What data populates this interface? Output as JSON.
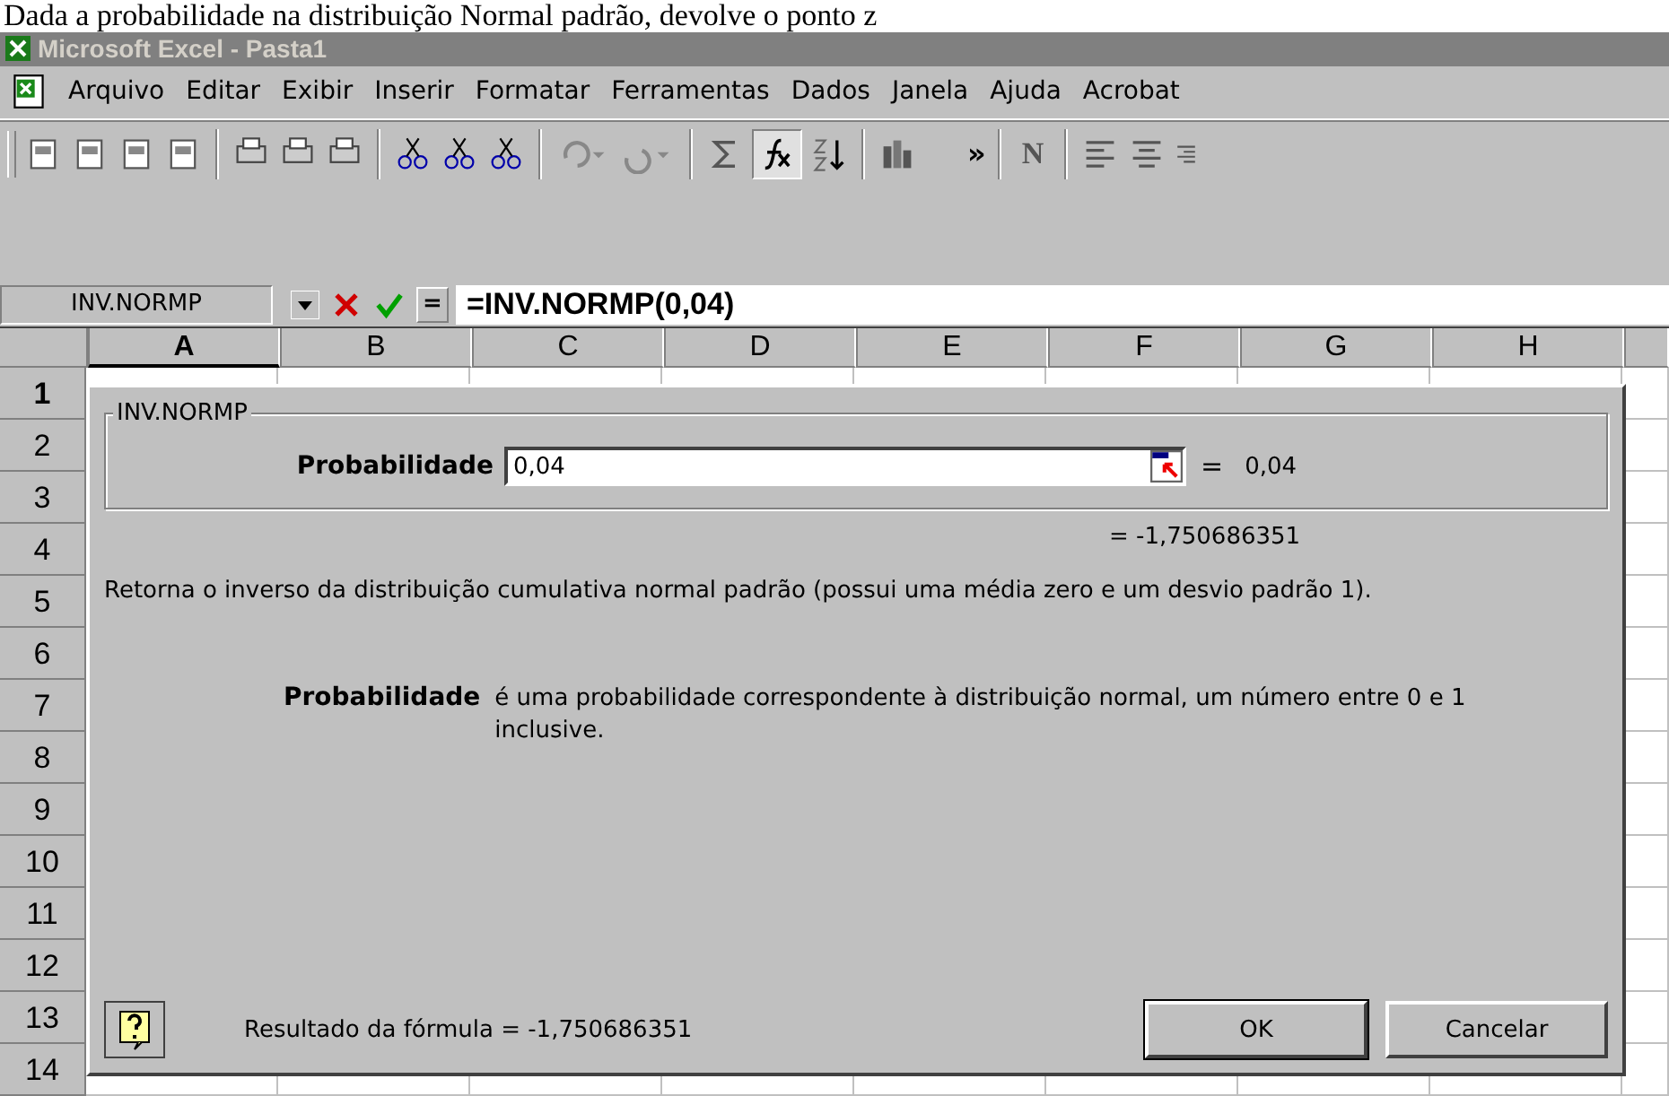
{
  "caption": "Dada a probabilidade na distribuição Normal padrão, devolve o ponto z",
  "window": {
    "title": "Microsoft Excel - Pasta1"
  },
  "menu": [
    "Arquivo",
    "Editar",
    "Exibir",
    "Inserir",
    "Formatar",
    "Ferramentas",
    "Dados",
    "Janela",
    "Ajuda",
    "Acrobat"
  ],
  "toolbar": {
    "more": "»",
    "bold": "N"
  },
  "formula_bar": {
    "name_box": "INV.NORMP",
    "equals": "=",
    "formula": "=INV.NORMP(0,04)"
  },
  "columns": [
    "A",
    "B",
    "C",
    "D",
    "E",
    "F",
    "G",
    "H"
  ],
  "rows": [
    "1",
    "2",
    "3",
    "4",
    "5",
    "6",
    "7",
    "8",
    "9",
    "10",
    "11",
    "12",
    "13",
    "14"
  ],
  "dialog": {
    "group_title": "INV.NORMP",
    "argument": {
      "label": "Probabilidade",
      "value": "0,04",
      "equals": "=",
      "result": "0,04"
    },
    "function_result": "=  -1,750686351",
    "description": "Retorna o inverso da distribuição cumulativa normal padrão (possui uma média zero e um desvio padrão 1).",
    "arg_help": {
      "name": "Probabilidade",
      "text": "é uma probabilidade correspondente à distribuição normal, um número entre 0 e 1 inclusive."
    },
    "formula_result": "Resultado da fórmula =  -1,750686351",
    "buttons": [
      "OK",
      "Cancelar"
    ]
  }
}
